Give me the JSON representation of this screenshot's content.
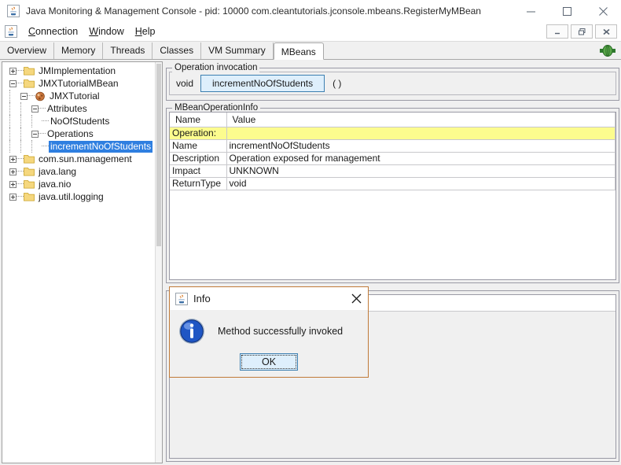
{
  "window": {
    "title": "Java Monitoring & Management Console - pid: 10000 com.cleantutorials.jconsole.mbeans.RegisterMyMBean",
    "app_icon": "java-cup-icon",
    "controls": {
      "minimize": "minimize-icon",
      "maximize": "maximize-icon",
      "close": "close-icon"
    }
  },
  "menubar": {
    "icon": "java-cup-icon",
    "items": [
      {
        "label": "Connection",
        "mnemonic": "C"
      },
      {
        "label": "Window",
        "mnemonic": "W"
      },
      {
        "label": "Help",
        "mnemonic": "H"
      }
    ],
    "inner_controls": {
      "minimize": "_",
      "restore": "❐",
      "close": "✕"
    }
  },
  "tabs": {
    "items": [
      {
        "label": "Overview",
        "selected": false
      },
      {
        "label": "Memory",
        "selected": false
      },
      {
        "label": "Threads",
        "selected": false
      },
      {
        "label": "Classes",
        "selected": false
      },
      {
        "label": "VM Summary",
        "selected": false
      },
      {
        "label": "MBeans",
        "selected": true
      }
    ],
    "status_icon": "connected-plug-icon"
  },
  "tree": {
    "nodes": [
      {
        "label": "JMImplementation",
        "depth": 0,
        "expander": "plus",
        "icon": "folder-icon",
        "selected": false
      },
      {
        "label": "JMXTutorialMBean",
        "depth": 0,
        "expander": "minus",
        "icon": "folder-icon",
        "selected": false
      },
      {
        "label": "JMXTutorial",
        "depth": 1,
        "expander": "minus",
        "icon": "mbean-icon",
        "selected": false
      },
      {
        "label": "Attributes",
        "depth": 2,
        "expander": "minus",
        "icon": "none",
        "selected": false
      },
      {
        "label": "NoOfStudents",
        "depth": 3,
        "expander": "none",
        "icon": "none",
        "selected": false
      },
      {
        "label": "Operations",
        "depth": 2,
        "expander": "minus",
        "icon": "none",
        "selected": false
      },
      {
        "label": "incrementNoOfStudents",
        "depth": 3,
        "expander": "none",
        "icon": "none",
        "selected": true
      },
      {
        "label": "com.sun.management",
        "depth": 0,
        "expander": "plus",
        "icon": "folder-icon",
        "selected": false
      },
      {
        "label": "java.lang",
        "depth": 0,
        "expander": "plus",
        "icon": "folder-icon",
        "selected": false
      },
      {
        "label": "java.nio",
        "depth": 0,
        "expander": "plus",
        "icon": "folder-icon",
        "selected": false
      },
      {
        "label": "java.util.logging",
        "depth": 0,
        "expander": "plus",
        "icon": "folder-icon",
        "selected": false
      }
    ]
  },
  "operation_invocation": {
    "title": "Operation invocation",
    "return_type": "void",
    "button_label": "incrementNoOfStudents",
    "parens": "( )"
  },
  "mbean_operation_info": {
    "title": "MBeanOperationInfo",
    "columns": [
      "Name",
      "Value"
    ],
    "rows": [
      {
        "name": "Operation:",
        "value": "",
        "highlight": true
      },
      {
        "name": "Name",
        "value": "incrementNoOfStudents",
        "highlight": false
      },
      {
        "name": "Description",
        "value": "Operation exposed for management",
        "highlight": false
      },
      {
        "name": "Impact",
        "value": "UNKNOWN",
        "highlight": false
      },
      {
        "name": "ReturnType",
        "value": "void",
        "highlight": false
      }
    ]
  },
  "dialog": {
    "icon": "java-cup-icon",
    "title": "Info",
    "close_icon": "close-icon",
    "message_icon": "info-circle-icon",
    "message": "Method successfully invoked",
    "ok_label": "OK"
  },
  "colors": {
    "accent_blue": "#3c7fb1",
    "button_fill": "#deeffc",
    "selection_blue": "#2f7fe0",
    "highlight_yellow": "#fcfc8e",
    "dialog_border": "#c07a38",
    "panel_bg": "#f0f0f0"
  }
}
